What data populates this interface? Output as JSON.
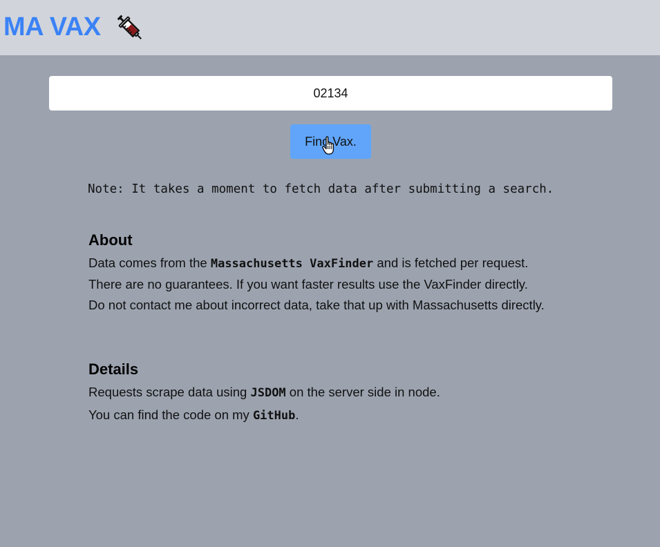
{
  "header": {
    "title": "MA VAX",
    "icon": "syringe-icon"
  },
  "search": {
    "value": "02134",
    "button_label": "Find Vax."
  },
  "note": "Note: It takes a moment to fetch data after submitting a search.",
  "about": {
    "title": "About",
    "line1_before": "Data comes from the ",
    "line1_link": "Massachusetts VaxFinder",
    "line1_after": " and is fetched per request.",
    "line2": "There are no guarantees. If you want faster results use the VaxFinder directly.",
    "line3": "Do not contact me about incorrect data, take that up with Massachusetts directly."
  },
  "details": {
    "title": "Details",
    "line1_before": "Requests scrape data using ",
    "line1_code": "JSDOM",
    "line1_after": " on the server side in node.",
    "line2_before": "You can find the code on my ",
    "line2_link": "GitHub",
    "line2_after": "."
  },
  "colors": {
    "brand": "#3b82f6",
    "header_bg": "#d1d5db",
    "page_bg": "#9ca3af",
    "button_bg": "#60a5fa"
  }
}
